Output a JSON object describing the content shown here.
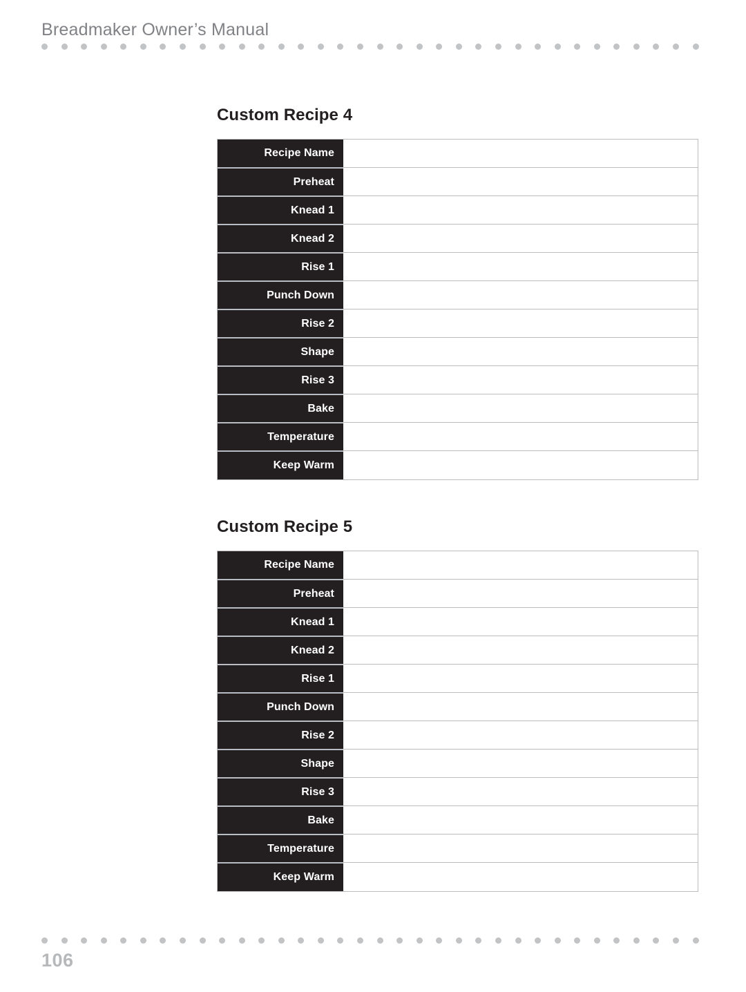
{
  "header": {
    "title": "Breadmaker Owner’s Manual"
  },
  "footer": {
    "page_number": "106"
  },
  "decor": {
    "dot_color": "#c1c3c5",
    "dot_count": 34
  },
  "colors": {
    "label_background": "#231f20",
    "label_text": "#ffffff",
    "heading_text": "#231f20",
    "header_text": "#808285",
    "page_number_text": "#b6b8ba",
    "cell_border": "#bcbcbc",
    "row_divider": "#b9bcc2"
  },
  "recipes": [
    {
      "heading": "Custom Recipe 4",
      "rows": [
        {
          "label": "Recipe Name",
          "value": ""
        },
        {
          "label": "Preheat",
          "value": ""
        },
        {
          "label": "Knead 1",
          "value": ""
        },
        {
          "label": "Knead 2",
          "value": ""
        },
        {
          "label": "Rise 1",
          "value": ""
        },
        {
          "label": "Punch Down",
          "value": ""
        },
        {
          "label": "Rise 2",
          "value": ""
        },
        {
          "label": "Shape",
          "value": ""
        },
        {
          "label": "Rise 3",
          "value": ""
        },
        {
          "label": "Bake",
          "value": ""
        },
        {
          "label": "Temperature",
          "value": ""
        },
        {
          "label": "Keep Warm",
          "value": ""
        }
      ]
    },
    {
      "heading": "Custom Recipe 5",
      "rows": [
        {
          "label": "Recipe Name",
          "value": ""
        },
        {
          "label": "Preheat",
          "value": ""
        },
        {
          "label": "Knead 1",
          "value": ""
        },
        {
          "label": "Knead 2",
          "value": ""
        },
        {
          "label": "Rise 1",
          "value": ""
        },
        {
          "label": "Punch Down",
          "value": ""
        },
        {
          "label": "Rise 2",
          "value": ""
        },
        {
          "label": "Shape",
          "value": ""
        },
        {
          "label": "Rise 3",
          "value": ""
        },
        {
          "label": "Bake",
          "value": ""
        },
        {
          "label": "Temperature",
          "value": ""
        },
        {
          "label": "Keep Warm",
          "value": ""
        }
      ]
    }
  ]
}
